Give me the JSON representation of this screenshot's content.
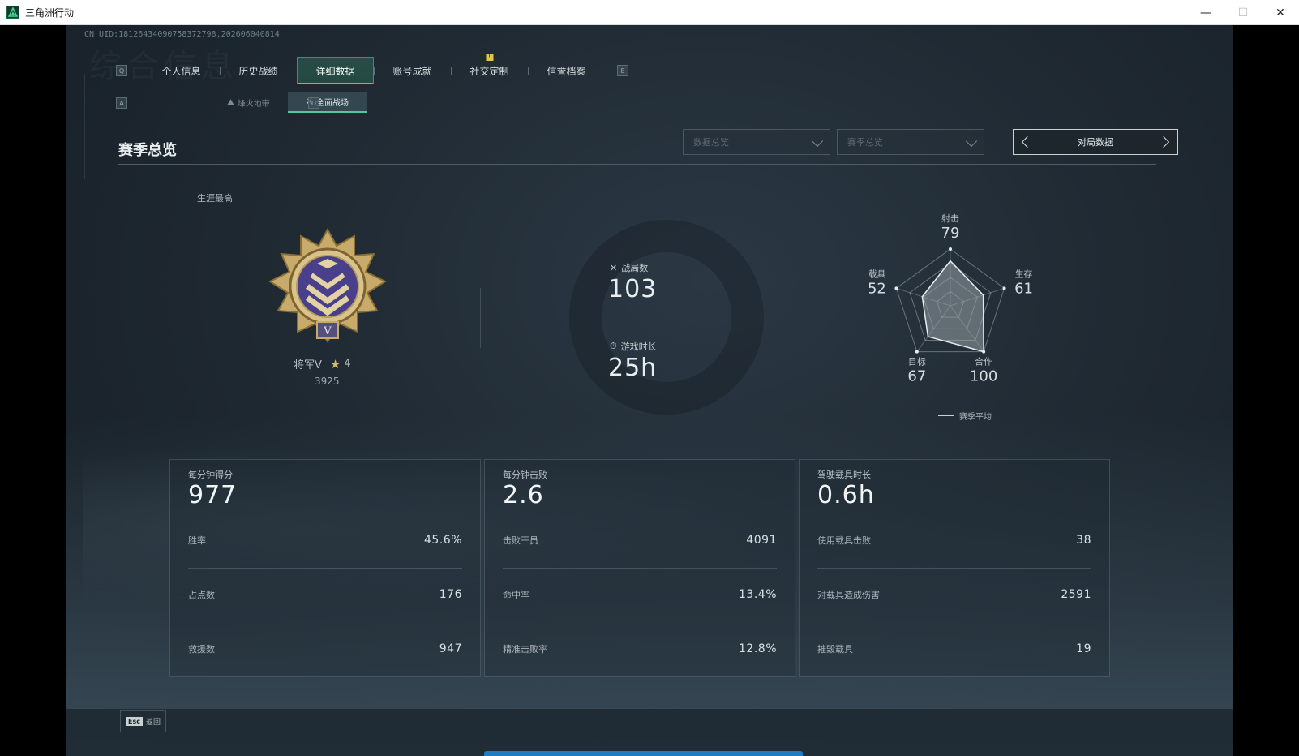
{
  "window": {
    "title": "三角洲行动",
    "minimize_glyph": "—",
    "maximize_glyph": "☐",
    "close_glyph": "✕"
  },
  "uid_text": "CN UID:18126434090758372798,202606040814",
  "watermark_text": "综合信息",
  "tabs": [
    {
      "label": "个人信息"
    },
    {
      "label": "历史战绩"
    },
    {
      "label": "详细数据",
      "active": true
    },
    {
      "label": "账号成就"
    },
    {
      "label": "社交定制",
      "badge": "!"
    },
    {
      "label": "信誉档案"
    }
  ],
  "tab_keys": {
    "left": "Q",
    "right": "E"
  },
  "subtabs": [
    {
      "label": "烽火地带",
      "icon": "hazard-zone-icon"
    },
    {
      "label": "全面战场",
      "icon": "battlefield-icon",
      "active": true
    }
  ],
  "subtab_keys": {
    "left": "A",
    "right": "D"
  },
  "section_title": "赛季总览",
  "filters": {
    "data_select": "数据总览",
    "season_select": "赛季总览",
    "pager_label": "对局数据"
  },
  "career": {
    "label": "生涯最高",
    "rank_name": "将军V",
    "rank_stars": "4",
    "rank_points": "3925",
    "medal_numeral": "V"
  },
  "stats": {
    "matches_label": "战局数",
    "matches_value": "103",
    "playtime_label": "游戏时长",
    "playtime_value": "25h"
  },
  "radar": {
    "axes": [
      {
        "label": "射击",
        "value": 79
      },
      {
        "label": "生存",
        "value": 61
      },
      {
        "label": "合作",
        "value": 100
      },
      {
        "label": "目标",
        "value": 67
      },
      {
        "label": "载具",
        "value": 52
      }
    ],
    "max": 100,
    "legend": "赛季平均"
  },
  "cards": [
    {
      "label": "每分钟得分",
      "value": "977",
      "rows": [
        {
          "k": "胜率",
          "v": "45.6%"
        },
        {
          "k": "占点数",
          "v": "176"
        },
        {
          "k": "救援数",
          "v": "947"
        }
      ]
    },
    {
      "label": "每分钟击败",
      "value": "2.6",
      "rows": [
        {
          "k": "击败干员",
          "v": "4091"
        },
        {
          "k": "命中率",
          "v": "13.4%"
        },
        {
          "k": "精准击败率",
          "v": "12.8%"
        }
      ]
    },
    {
      "label": "驾驶载具时长",
      "value": "0.6h",
      "rows": [
        {
          "k": "使用载具击败",
          "v": "38"
        },
        {
          "k": "对载具造成伤害",
          "v": "2591"
        },
        {
          "k": "摧毁载具",
          "v": "19"
        }
      ]
    }
  ],
  "footer": {
    "esc_key": "Esc",
    "esc_label": "返回"
  },
  "colors": {
    "accent": "#56c79a",
    "badge": "#e6c34a",
    "progress": "#1d7cc2"
  }
}
